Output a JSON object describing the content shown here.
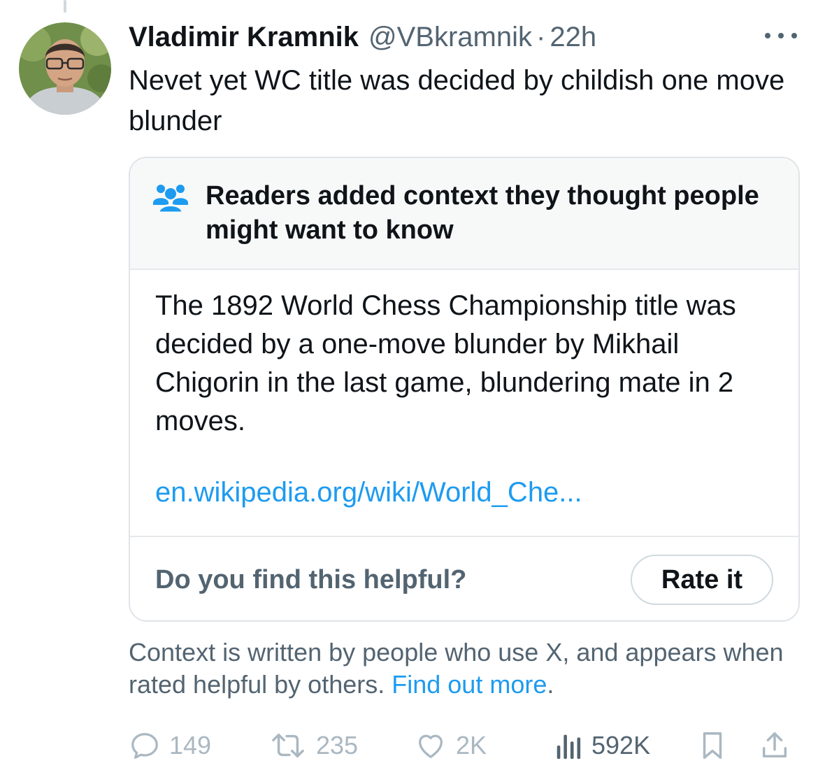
{
  "tweet": {
    "display_name": "Vladimir Kramnik",
    "handle": "@VBkramnik",
    "separator": "·",
    "time": "22h",
    "text": "Nevet yet WC title was decided by childish one move blunder"
  },
  "community_note": {
    "title": "Readers added context they thought people might want to know",
    "body": "The 1892 World Chess Championship title was decided by a one-move blunder by Mikhail Chigorin in the last game, blundering mate in 2 moves.",
    "link": "en.wikipedia.org/wiki/World_Che...",
    "helpful_question": "Do you find this helpful?",
    "rate_button": "Rate it",
    "people_icon": "people-icon"
  },
  "disclaimer": {
    "text": "Context is written by people who use X, and appears when rated helpful by others.",
    "link": "Find out more",
    "suffix": "."
  },
  "actions": {
    "replies": "149",
    "retweets": "235",
    "likes": "2K",
    "views": "592K"
  },
  "colors": {
    "link": "#1d9bf0",
    "secondary_text": "#536471",
    "note_header_bg": "#f7f9f9",
    "border": "#dfe4e8"
  }
}
